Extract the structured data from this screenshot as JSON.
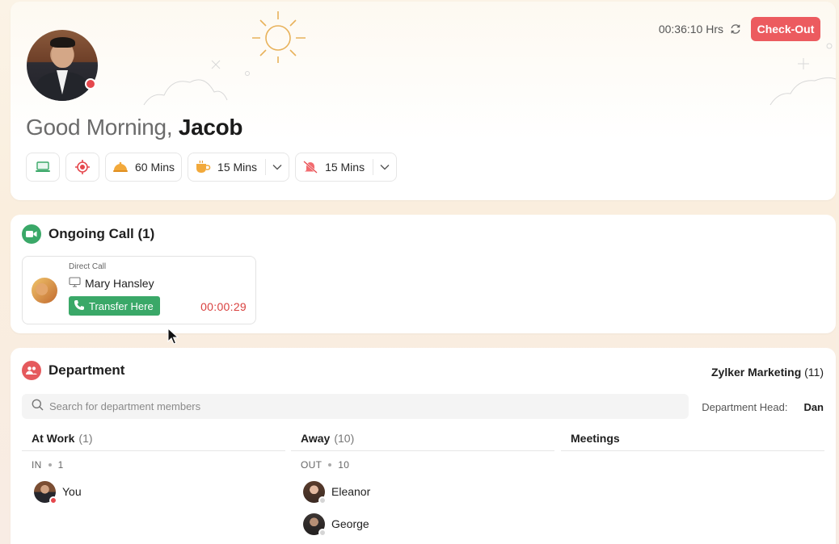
{
  "hero": {
    "greeting_prefix": "Good Morning,",
    "user_name": "Jacob",
    "elapsed_time": "00:36:10 Hrs",
    "checkout_label": "Check-Out",
    "chips": {
      "lunch_label": "60 Mins",
      "coffee_label": "15 Mins",
      "dnd_label": "15 Mins"
    },
    "icons": [
      "laptop-icon",
      "target-icon",
      "food-bell-icon",
      "coffee-icon",
      "bell-off-icon",
      "refresh-icon",
      "sun-icon"
    ]
  },
  "call": {
    "title": "Ongoing Call (1)",
    "call_type": "Direct Call",
    "caller_name": "Mary Hansley",
    "transfer_label": "Transfer Here",
    "duration": "00:00:29"
  },
  "department": {
    "title": "Department",
    "name": "Zylker Marketing",
    "member_count": "(11)",
    "search_placeholder": "Search for department members",
    "head_label": "Department Head:",
    "head_name": "Dan",
    "columns": [
      {
        "title": "At Work",
        "count": "(1)",
        "sub_label": "IN",
        "sub_count": "1",
        "members": [
          "You"
        ]
      },
      {
        "title": "Away",
        "count": "(10)",
        "sub_label": "OUT",
        "sub_count": "10",
        "members": [
          "Eleanor",
          "George"
        ]
      },
      {
        "title": "Meetings",
        "count": ""
      }
    ]
  },
  "colors": {
    "accent_red": "#ec5b5f",
    "call_green": "#3aa868",
    "duration_red": "#d9413f",
    "status_red": "#e5484d",
    "dept_icon_red": "#e55a5d",
    "call_icon_green": "#3aa868"
  }
}
